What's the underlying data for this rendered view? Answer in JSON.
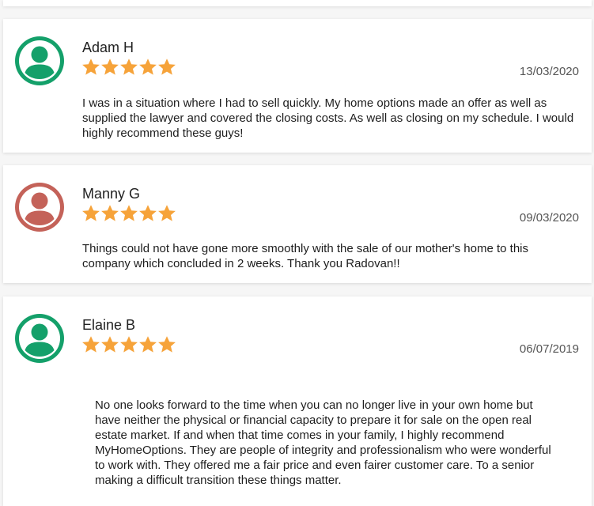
{
  "colors": {
    "avatar_green": "#14a06a",
    "avatar_red": "#c46259",
    "star": "#f6a33a"
  },
  "reviews": [
    {
      "name": "Adam H",
      "rating": 5,
      "date": "13/03/2020",
      "avatar_color": "#14a06a",
      "text": "I was in a situation where I had to sell quickly. My home options made an offer as well as supplied the lawyer and covered the closing costs. As well as closing on my schedule. I would highly recommend these guys!"
    },
    {
      "name": "Manny G",
      "rating": 5,
      "date": "09/03/2020",
      "avatar_color": "#c46259",
      "text": "Things could not have gone more smoothly with the sale of our mother's home to this company which concluded in 2 weeks. Thank you Radovan!!"
    },
    {
      "name": "Elaine B",
      "rating": 5,
      "date": "06/07/2019",
      "avatar_color": "#14a06a",
      "text": "No one looks forward to the time when you can no longer live in your own home but have neither the physical or financial capacity to prepare it for sale on the open real estate market. If and when that time comes in your family, I highly recommend MyHomeOptions. They are people of integrity and professionalism who were wonderful to work with. They offered me a fair price and even fairer customer care. To a senior making a difficult transition these things matter."
    }
  ]
}
